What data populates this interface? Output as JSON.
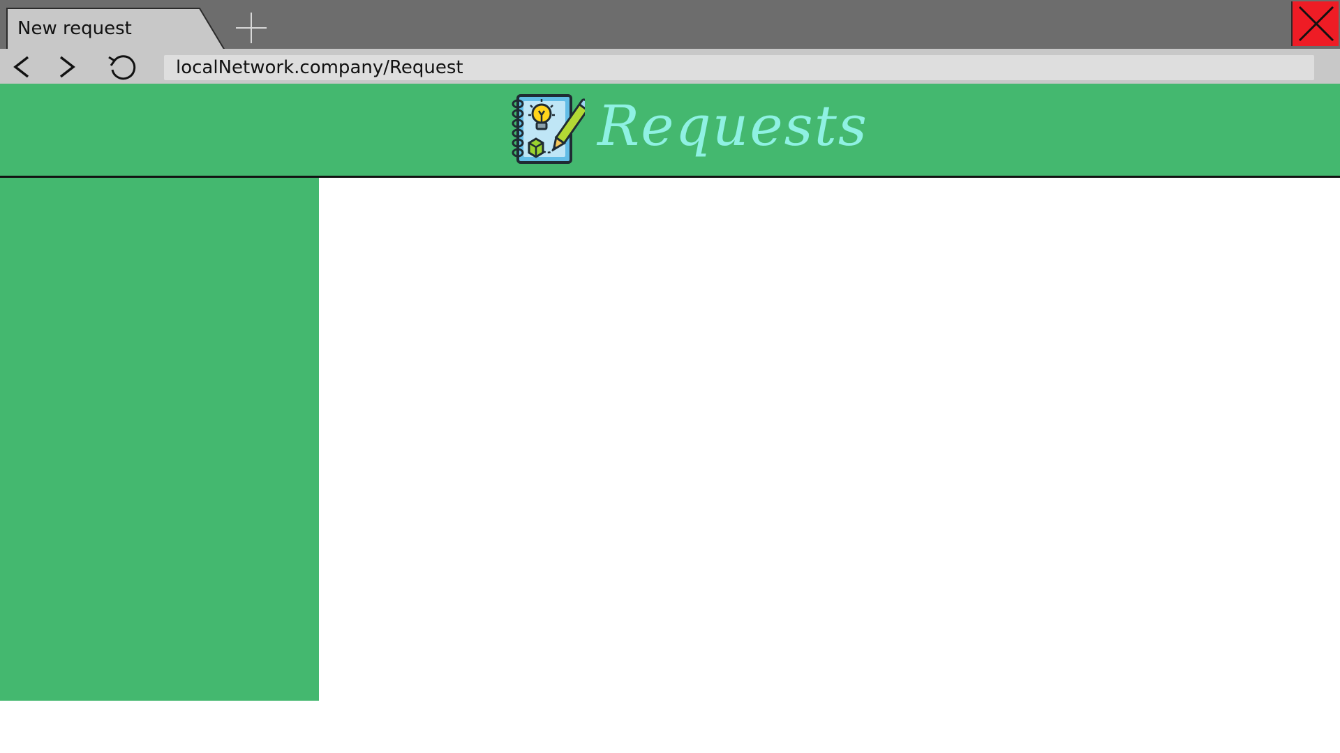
{
  "browser": {
    "tab": {
      "label": "New request"
    },
    "address_bar": {
      "url": "localNetwork.company/Request"
    },
    "icons": {
      "new_tab": "plus-icon",
      "close_window": "close-icon",
      "back": "chevron-left-icon",
      "forward": "chevron-right-icon",
      "reload": "reload-icon"
    },
    "colors": {
      "tab_strip": "#6d6d6d",
      "active_tab": "#c8c8c8",
      "close_button": "#ee1c25"
    }
  },
  "app": {
    "header": {
      "title": "Requests",
      "logo_icon": "notebook-idea-icon",
      "background": "#44b86f",
      "title_color": "#8ff1e3"
    },
    "sidebar": {
      "background": "#44b86f"
    }
  }
}
